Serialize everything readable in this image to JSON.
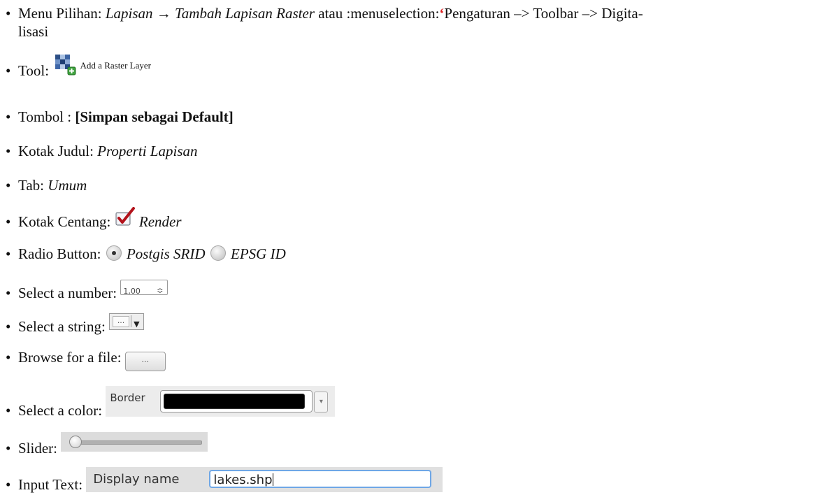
{
  "bullet": "•",
  "items": {
    "menu": {
      "label": "Menu Pilihan: ",
      "path1": "Lapisan",
      "arrow": "→",
      "path2": "Tambah Lapisan Raster",
      "middle": " atau :menuselection:",
      "quote": "‘",
      "rest": "Pengaturan –> Toolbar –> Digita-",
      "wrap": "lisasi"
    },
    "tool": {
      "label": "Tool: ",
      "icon": "raster-layer-add-icon",
      "caption": "Add a Raster Layer"
    },
    "button": {
      "label": "Tombol : ",
      "value": "[Simpan sebagai Default]"
    },
    "title": {
      "label": "Kotak Judul: ",
      "value": "Properti Lapisan"
    },
    "tab": {
      "label": "Tab: ",
      "value": "Umum"
    },
    "checkbox": {
      "label": "Kotak Centang: ",
      "value": "Render",
      "checked": true
    },
    "radio": {
      "label": "Radio Button: ",
      "option1": "Postgis SRID",
      "option2": "EPSG ID",
      "selected": "Postgis SRID"
    },
    "number": {
      "label": "Select a number: ",
      "value": "1,00",
      "spin": "≎"
    },
    "string": {
      "label": "Select a string: ",
      "dots": "...",
      "arrow": "▼"
    },
    "browse": {
      "label": "Browse for a file: ",
      "button": "..."
    },
    "color": {
      "label": "Select a color: ",
      "widget_label": "Border",
      "color": "#000000",
      "arrow": "▾"
    },
    "slider": {
      "label": "Slider: ",
      "value": 0
    },
    "input": {
      "label": "Input Text: ",
      "widget_label": "Display name",
      "value": "lakes.shp"
    }
  }
}
